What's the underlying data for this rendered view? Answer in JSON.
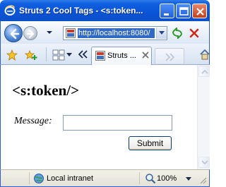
{
  "window": {
    "title": "Struts 2 Cool Tags - <s:token..."
  },
  "address": {
    "url": "http://localhost:8080/"
  },
  "tabs": [
    {
      "label": "Struts ...",
      "active": true
    }
  ],
  "page": {
    "heading": "<s:token/>",
    "form": {
      "message_label": "Message:",
      "message_value": "",
      "submit_label": "Submit"
    }
  },
  "status": {
    "zone": "Local intranet",
    "zoom": "100%"
  },
  "icons": {
    "app": "ie-logo-icon",
    "back": "back-arrow-icon",
    "forward": "forward-arrow-icon",
    "refresh": "refresh-icon",
    "stop": "stop-icon",
    "favorites": "favorites-star-icon",
    "add_favorites": "add-favorites-icon",
    "quick_tabs": "quick-tabs-icon",
    "zone": "local-intranet-icon",
    "zoom": "zoom-icon"
  },
  "colors": {
    "titlebar": "#0a55d8",
    "address_selection": "#316ac5",
    "close_button": "#c5401a"
  }
}
